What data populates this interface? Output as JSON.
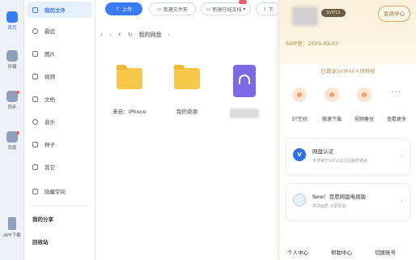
{
  "rail": {
    "items": [
      {
        "label": "首页"
      },
      {
        "label": "传输"
      },
      {
        "label": "同步"
      },
      {
        "label": "消息"
      },
      {
        "label": "APP下载"
      }
    ]
  },
  "nav": {
    "items": [
      {
        "label": "我的文件"
      },
      {
        "label": "最近"
      },
      {
        "label": "图片"
      },
      {
        "label": "视频"
      },
      {
        "label": "文档"
      },
      {
        "label": "音乐"
      },
      {
        "label": "种子"
      },
      {
        "label": "其它"
      },
      {
        "label": "隐藏空间"
      },
      {
        "label": "我的分享"
      },
      {
        "label": "回收站"
      }
    ]
  },
  "toolbar": {
    "upload": "上传",
    "new_folder": "新建文件夹",
    "new_online_doc": "新建在线文档",
    "download_label": "下"
  },
  "breadcrumb": {
    "current": "我的网盘"
  },
  "files": [
    {
      "label": "来自：iPhone"
    },
    {
      "label": "我的资源"
    }
  ],
  "panel": {
    "tag": "SVIP12",
    "vip_center": "会员中心",
    "expiry": "SVIP至：2025-03-03",
    "benefits_title": "已尊享SVIP40+项特权",
    "features": [
      {
        "label": "5T空间"
      },
      {
        "label": "极速下载"
      },
      {
        "label": "视频备份"
      },
      {
        "label": "查看更多"
      }
    ],
    "cards": [
      {
        "title": "网盘认证",
        "sub": "专享官方VIP认证企业服务通道"
      },
      {
        "title": "New！百度网盘电视版",
        "sub": "高清画质 大屏体验"
      }
    ],
    "footer": [
      "个人中心",
      "帮助中心",
      "切换账号"
    ]
  }
}
